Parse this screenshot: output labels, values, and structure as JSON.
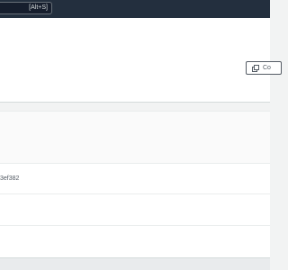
{
  "topbar": {
    "search_shortcut": "[Alt+S]"
  },
  "header": {
    "copy_button_label": "Co"
  },
  "details": {
    "rows": [
      {
        "value": "3ef382"
      },
      {
        "value": ""
      },
      {
        "value": ""
      }
    ]
  }
}
